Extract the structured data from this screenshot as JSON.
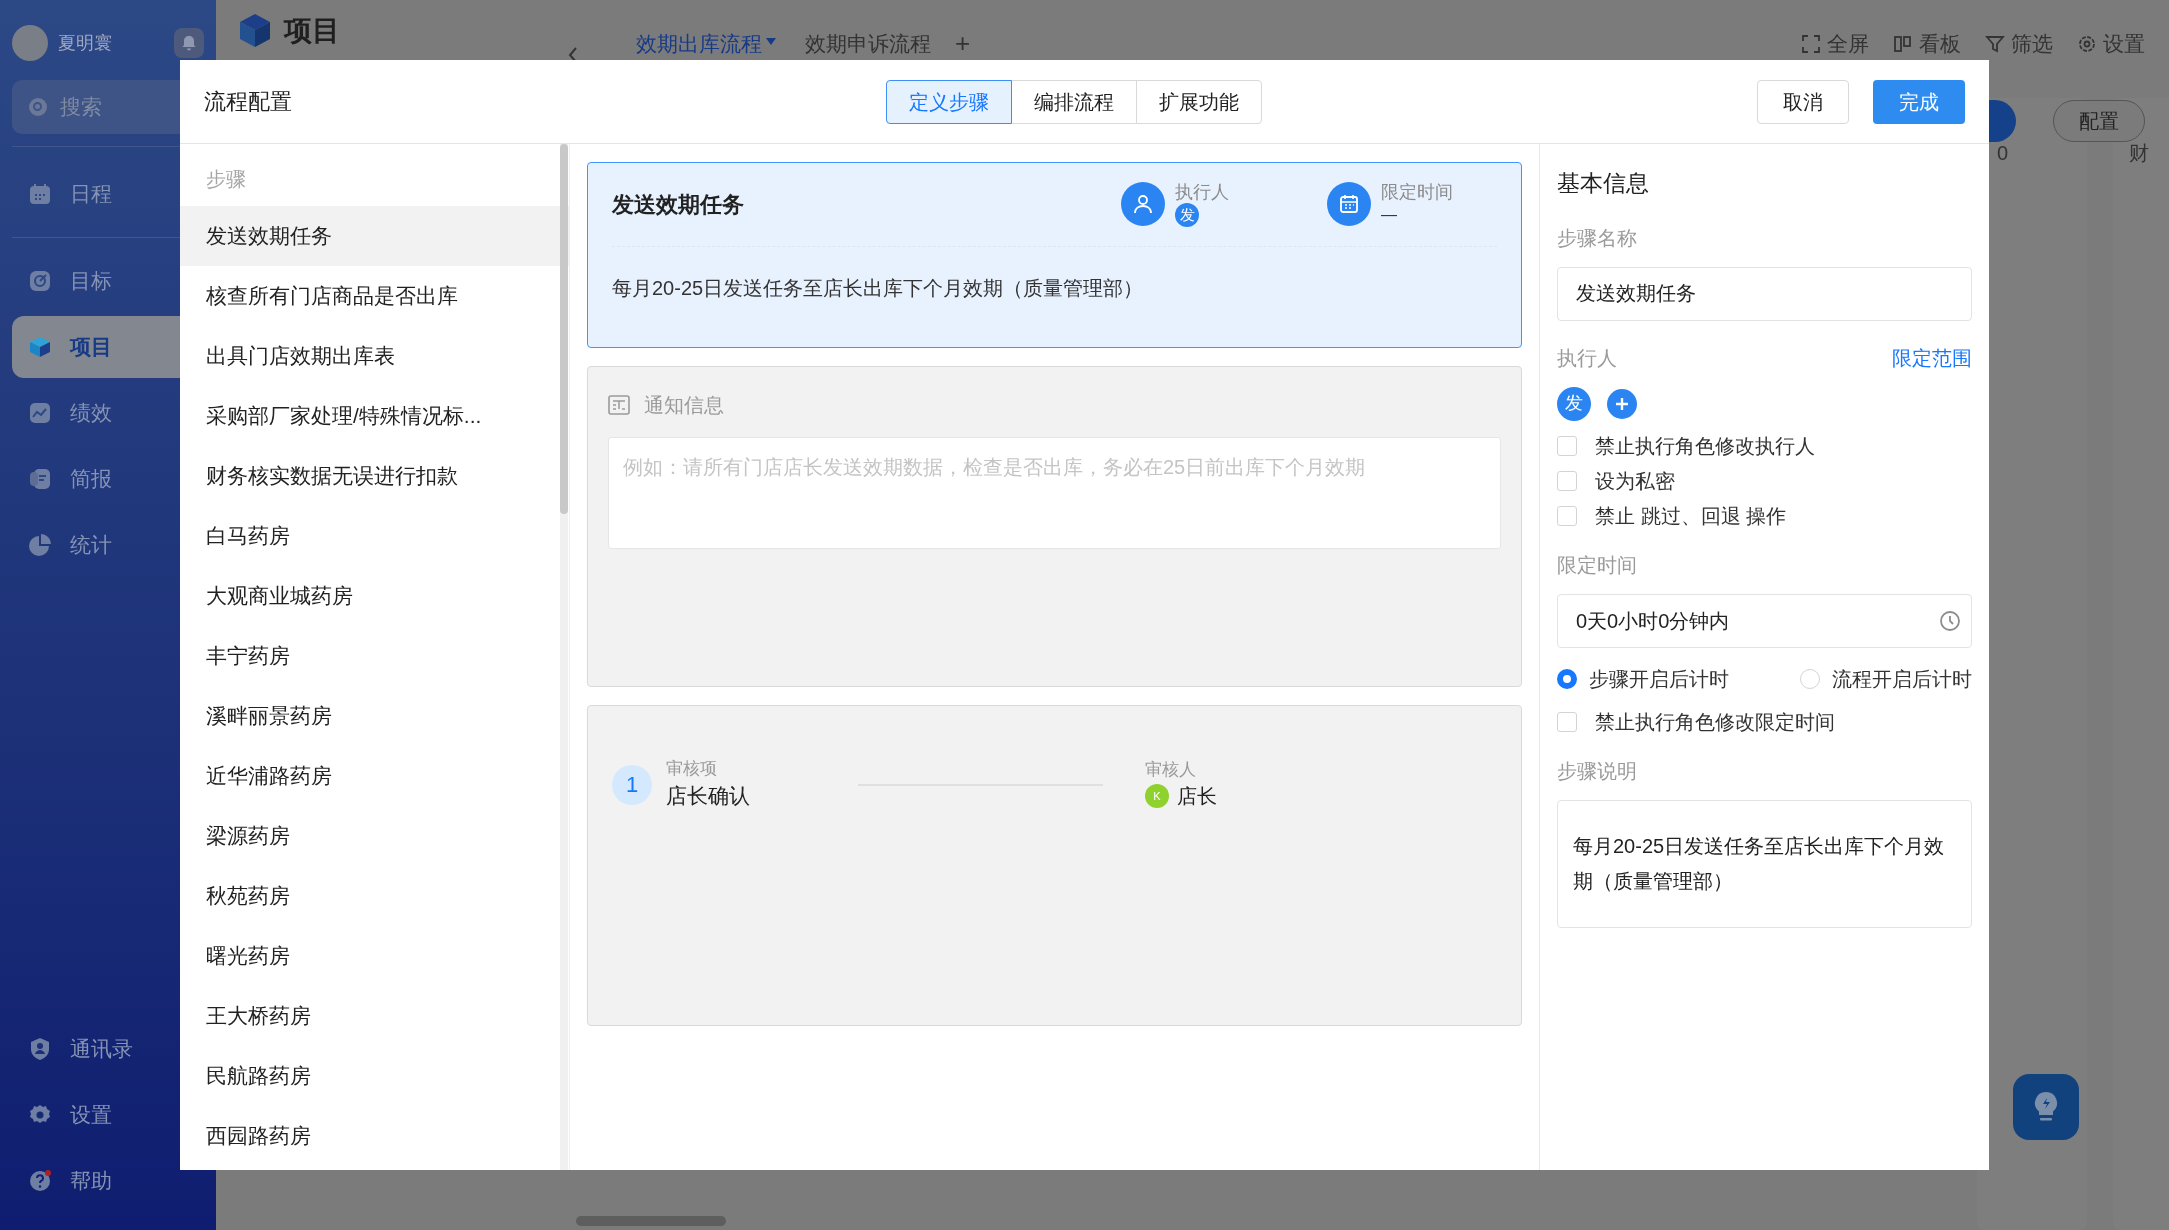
{
  "app": {
    "user_name": "夏明寰",
    "search_placeholder": "搜索",
    "nav": [
      {
        "label": "日程",
        "selected": false
      },
      {
        "label": "目标",
        "selected": false
      },
      {
        "label": "项目",
        "selected": true
      },
      {
        "label": "绩效",
        "selected": false
      },
      {
        "label": "简报",
        "selected": false
      },
      {
        "label": "统计",
        "selected": false
      }
    ],
    "nav_bottom": [
      {
        "label": "通讯录"
      },
      {
        "label": "设置"
      },
      {
        "label": "帮助"
      }
    ],
    "page_title": "项目",
    "flow_tabs": [
      {
        "label": "效期出库流程",
        "selected": true
      },
      {
        "label": "效期申诉流程",
        "selected": false
      }
    ],
    "add_tab": "+",
    "toolbar": [
      "全屏",
      "看板",
      "筛选",
      "设置"
    ],
    "config_button": "配置",
    "column_values": [
      "0",
      "财"
    ]
  },
  "modal": {
    "title": "流程配置",
    "tabs": [
      {
        "label": "定义步骤",
        "selected": true
      },
      {
        "label": "编排流程",
        "selected": false
      },
      {
        "label": "扩展功能",
        "selected": false
      }
    ],
    "cancel": "取消",
    "done": "完成"
  },
  "steps": {
    "heading": "步骤",
    "items": [
      {
        "label": "发送效期任务",
        "selected": true
      },
      {
        "label": "核查所有门店商品是否出库",
        "selected": false
      },
      {
        "label": "出具门店效期出库表",
        "selected": false
      },
      {
        "label": "采购部厂家处理/特殊情况标...",
        "selected": false
      },
      {
        "label": "财务核实数据无误进行扣款",
        "selected": false
      },
      {
        "label": "白马药房",
        "selected": false
      },
      {
        "label": "大观商业城药房",
        "selected": false
      },
      {
        "label": "丰宁药房",
        "selected": false
      },
      {
        "label": "溪畔丽景药房",
        "selected": false
      },
      {
        "label": "近华浦路药房",
        "selected": false
      },
      {
        "label": "梁源药房",
        "selected": false
      },
      {
        "label": "秋苑药房",
        "selected": false
      },
      {
        "label": "曙光药房",
        "selected": false
      },
      {
        "label": "王大桥药房",
        "selected": false
      },
      {
        "label": "民航路药房",
        "selected": false
      },
      {
        "label": "西园路药房",
        "selected": false
      }
    ]
  },
  "step_card": {
    "title": "发送效期任务",
    "executor_label": "执行人",
    "executor_avatar": "发",
    "time_label": "限定时间",
    "time_value": "—",
    "description": "每月20-25日发送任务至店长出库下个月效期（质量管理部）"
  },
  "notice": {
    "title": "通知信息",
    "placeholder": "例如：请所有门店店长发送效期数据，检查是否出库，务必在25日前出库下个月效期"
  },
  "review": {
    "index": "1",
    "item_label": "审核项",
    "item_value": "店长确认",
    "reviewer_label": "审核人",
    "reviewer_avatar": "K",
    "reviewer_name": "店长"
  },
  "basic_info": {
    "heading": "基本信息",
    "name_label": "步骤名称",
    "name_value": "发送效期任务",
    "executor_label": "执行人",
    "scope_link": "限定范围",
    "executor_avatar": "发",
    "executor_options": [
      {
        "label": "禁止执行角色修改执行人",
        "checked": false
      },
      {
        "label": "设为私密",
        "checked": false
      },
      {
        "label": "禁止 跳过、回退 操作",
        "checked": false
      }
    ],
    "time_label": "限定时间",
    "time_value": "0天0小时0分钟内",
    "timer_modes": [
      {
        "label": "步骤开启后计时",
        "selected": true
      },
      {
        "label": "流程开启后计时",
        "selected": false
      }
    ],
    "time_options": [
      {
        "label": "禁止执行角色修改限定时间",
        "checked": false
      }
    ],
    "desc_label": "步骤说明",
    "desc_value": "每月20-25日发送任务至店长出库下个月效期（质量管理部）"
  }
}
